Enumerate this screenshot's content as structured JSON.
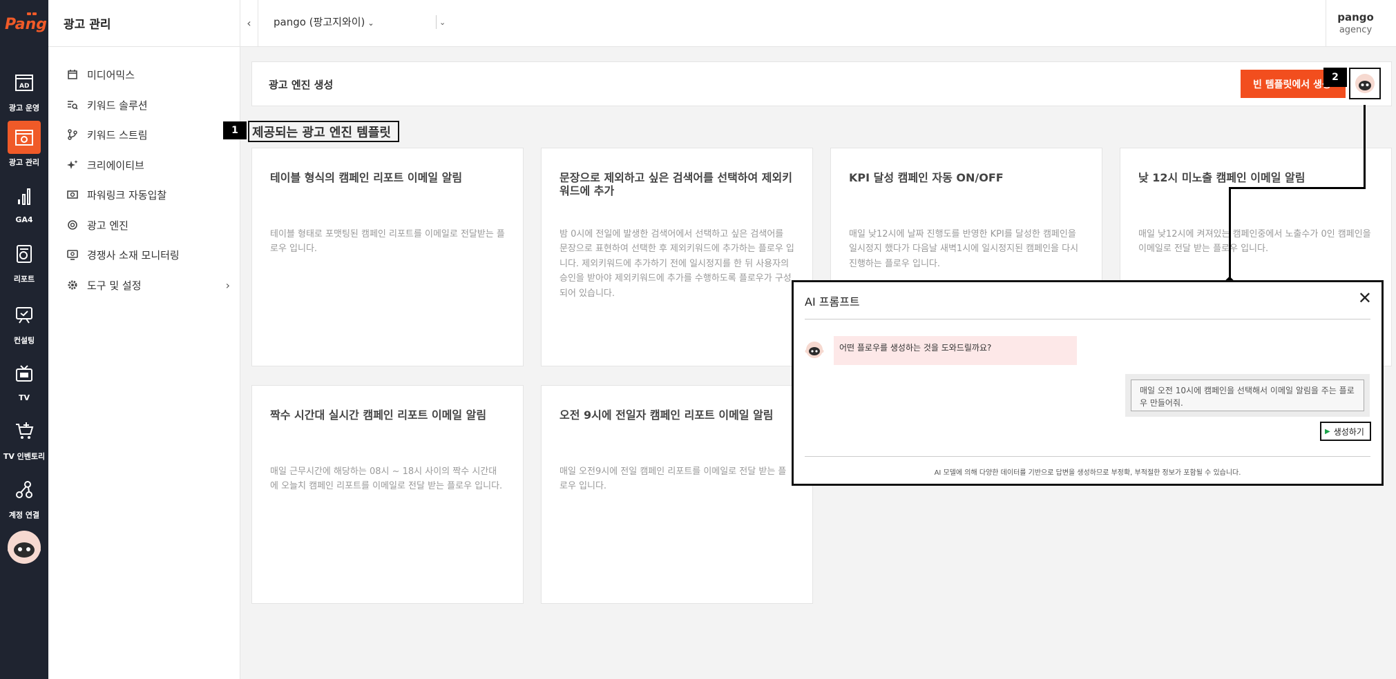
{
  "rail": {
    "logo_text": "Pango",
    "items": [
      {
        "label": "광고 운영",
        "icon": "ad-icon"
      },
      {
        "label": "광고 관리",
        "icon": "ad-settings-icon"
      },
      {
        "label": "GA4",
        "icon": "bar-chart-icon"
      },
      {
        "label": "리포트",
        "icon": "report-icon"
      },
      {
        "label": "컨설팅",
        "icon": "consulting-icon"
      },
      {
        "label": "TV",
        "icon": "tv-icon"
      },
      {
        "label": "TV 인벤토리",
        "icon": "cart-icon"
      },
      {
        "label": "계정 연결",
        "icon": "link-icon"
      }
    ],
    "active_index": 1
  },
  "sidebar": {
    "title": "광고 관리",
    "items": [
      {
        "label": "미디어믹스",
        "icon": "calendar-icon"
      },
      {
        "label": "키워드 솔루션",
        "icon": "keyword-search-icon"
      },
      {
        "label": "키워드 스트림",
        "icon": "branch-icon"
      },
      {
        "label": "크리에이티브",
        "icon": "sparkle-icon"
      },
      {
        "label": "파워링크 자동입찰",
        "icon": "auto-bid-icon"
      },
      {
        "label": "광고 엔진",
        "icon": "engine-icon"
      },
      {
        "label": "경쟁사 소재 모니터링",
        "icon": "monitor-icon"
      },
      {
        "label": "도구 및 설정",
        "icon": "gear-icon"
      }
    ]
  },
  "topbar": {
    "account": "pango (팡고지와이)",
    "user_name": "pango",
    "user_role": "agency"
  },
  "engine": {
    "title": "광고 엔진 생성",
    "blank_template_button": "빈 템플릿에서 생성",
    "badge_one": "1",
    "badge_two": "2"
  },
  "templates_section_title": "제공되는 광고 엔진 템플릿",
  "templates": [
    {
      "title": "테이블 형식의 캠페인 리포트 이메일 알림",
      "desc": "테이블 형태로 포맷팅된 캠페인 리포트를 이메일로 전달받는 플로우 입니다."
    },
    {
      "title": "문장으로 제외하고 싶은 검색어를 선택하여 제외키워드에 추가",
      "desc": "밤 0시에 전일에 발생한 검색어에서 선택하고 싶은 검색어를 문장으로 표현하여 선택한 후 제외키워드에 추가하는 플로우 입니다. 제외키워드에 추가하기 전에 일시정지를 한 뒤 사용자의 승인을 받아야 제외키워드에 추가를 수행하도록 플로우가 구성되어 있습니다."
    },
    {
      "title": "KPI 달성 캠페인 자동 ON/OFF",
      "desc": "매일 낮12시에 날짜 진행도를 반영한 KPI를 달성한 캠페인을 일시정지 했다가 다음날 새벽1시에 일시정지된 캠페인을 다시 진행하는 플로우 입니다."
    },
    {
      "title": "낮 12시 미노출 캠페인 이메일 알림",
      "desc": "매일 낮12시에 켜져있는 캠페인중에서 노출수가 0인 캠페인을 이메일로 전달 받는 플로우 입니다."
    },
    {
      "title": "짝수 시간대 실시간 캠페인 리포트 이메일 알림",
      "desc": "매일 근무시간에 해당하는 08시 ~ 18시 사이의 짝수 시간대에 오늘치 캠페인 리포트를 이메일로 전달 받는 플로우 입니다."
    },
    {
      "title": "오전 9시에 전일자 캠페인 리포트 이메일 알림",
      "desc": "매일 오전9시에 전일 캠페인 리포트를 이메일로 전달 받는 플로우 입니다."
    }
  ],
  "ai_modal": {
    "title": "AI 프롬프트",
    "bot_message": "어떤 플로우를 생성하는 것을 도와드릴까요?",
    "user_input_value": "매일 오전 10시에 캠페인을 선택해서 이메일 알림을 주는 플로우 만들어줘.",
    "generate_button": "생성하기",
    "disclaimer": "AI 모델에 의해 다양한 데이터를 기반으로 답변을 생성하므로 부정확, 부적절한 정보가 포함될 수 있습니다."
  },
  "colors": {
    "accent": "#f24e1e",
    "rail_bg": "#1f2430",
    "bot_bubble": "#fde8e8"
  }
}
